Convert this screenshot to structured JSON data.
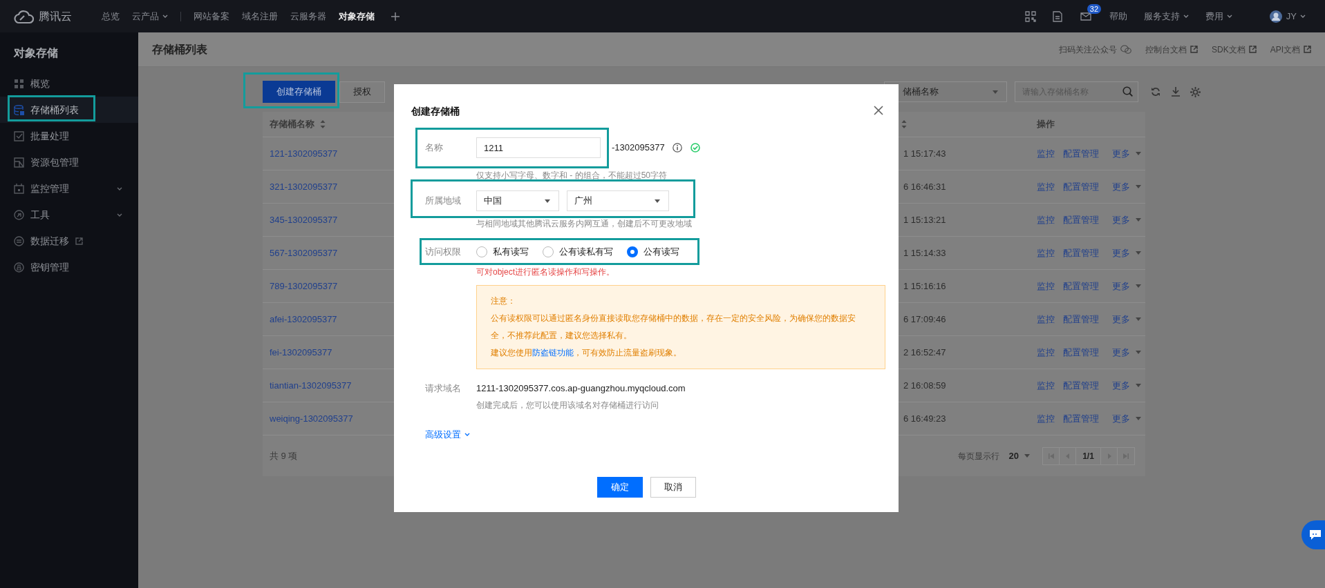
{
  "top_nav": {
    "brand": "腾讯云",
    "items": [
      {
        "label": "总览",
        "selected": false,
        "dropdown": false
      },
      {
        "label": "云产品",
        "selected": false,
        "dropdown": true
      },
      {
        "label": "网站备案",
        "selected": false,
        "dropdown": false
      },
      {
        "label": "域名注册",
        "selected": false,
        "dropdown": false
      },
      {
        "label": "云服务器",
        "selected": false,
        "dropdown": false
      },
      {
        "label": "对象存储",
        "selected": true,
        "dropdown": false
      }
    ],
    "mail_badge": "32",
    "links": [
      {
        "label": "帮助",
        "dropdown": false
      },
      {
        "label": "服务支持",
        "dropdown": true
      },
      {
        "label": "费用",
        "dropdown": true
      }
    ],
    "user": "JY"
  },
  "sidebar": {
    "title": "对象存储",
    "items": [
      {
        "label": "概览",
        "selected": false,
        "expandable": false,
        "external": false
      },
      {
        "label": "存储桶列表",
        "selected": true,
        "expandable": false,
        "external": false
      },
      {
        "label": "批量处理",
        "selected": false,
        "expandable": false,
        "external": false
      },
      {
        "label": "资源包管理",
        "selected": false,
        "expandable": false,
        "external": false
      },
      {
        "label": "监控管理",
        "selected": false,
        "expandable": true,
        "external": false
      },
      {
        "label": "工具",
        "selected": false,
        "expandable": true,
        "external": false
      },
      {
        "label": "数据迁移",
        "selected": false,
        "expandable": false,
        "external": true
      },
      {
        "label": "密钥管理",
        "selected": false,
        "expandable": false,
        "external": false
      }
    ]
  },
  "page_header": {
    "title": "存储桶列表",
    "links": [
      {
        "label": "扫码关注公众号",
        "kind": "wechat"
      },
      {
        "label": "控制台文档",
        "kind": "external"
      },
      {
        "label": "SDK文档",
        "kind": "external"
      },
      {
        "label": "API文档",
        "kind": "external"
      }
    ]
  },
  "toolbar": {
    "create_button": "创建存储桶",
    "auth_button": "授权",
    "filter_select": "储桶名称",
    "search": {
      "placeholder": "请输入存储桶名称"
    }
  },
  "table": {
    "columns": {
      "name": "存储桶名称",
      "actions": "操作"
    },
    "rows": [
      {
        "name": "121-1302095377",
        "column_2": "1 15:17:43",
        "actions": [
          "监控",
          "配置管理",
          "更多"
        ]
      },
      {
        "name": "321-1302095377",
        "column_2": "6 16:46:31",
        "actions": [
          "监控",
          "配置管理",
          "更多"
        ]
      },
      {
        "name": "345-1302095377",
        "column_2": "1 15:13:21",
        "actions": [
          "监控",
          "配置管理",
          "更多"
        ]
      },
      {
        "name": "567-1302095377",
        "column_2": "1 15:14:33",
        "actions": [
          "监控",
          "配置管理",
          "更多"
        ]
      },
      {
        "name": "789-1302095377",
        "column_2": "1 15:16:16",
        "actions": [
          "监控",
          "配置管理",
          "更多"
        ]
      },
      {
        "name": "afei-1302095377",
        "column_2": "6 17:09:46",
        "actions": [
          "监控",
          "配置管理",
          "更多"
        ]
      },
      {
        "name": "fei-1302095377",
        "column_2": "2 16:52:47",
        "actions": [
          "监控",
          "配置管理",
          "更多"
        ]
      },
      {
        "name": "tiantian-1302095377",
        "column_2": "2 16:08:59",
        "actions": [
          "监控",
          "配置管理",
          "更多"
        ]
      },
      {
        "name": "weiqing-1302095377",
        "column_2": "6 16:49:23",
        "actions": [
          "监控",
          "配置管理",
          "更多"
        ]
      }
    ],
    "footer": {
      "total": "共 9 项",
      "page_size_label": "每页显示行",
      "page_size": "20",
      "page": "1/1"
    }
  },
  "modal": {
    "title": "创建存储桶",
    "name": {
      "label": "名称",
      "value": "1211",
      "suffix": "-1302095377",
      "valid": true,
      "hint": "仅支持小写字母、数字和 - 的组合，不能超过50字符"
    },
    "region": {
      "label": "所属地域",
      "selects": [
        "中国",
        "广州"
      ],
      "hint": "与相同地域其他腾讯云服务内网互通，创建后不可更改地域"
    },
    "access": {
      "label": "访问权限",
      "options": [
        {
          "label": "私有读写",
          "selected": false
        },
        {
          "label": "公有读私有写",
          "selected": false
        },
        {
          "label": "公有读写",
          "selected": true
        }
      ],
      "warning": "可对object进行匿名读操作和写操作。",
      "notice": {
        "title": "注意：",
        "text": "公有读权限可以通过匿名身份直接读取您存储桶中的数据，存在一定的安全风险，为确保您的数据安全，不推荐此配置，建议您选择私有。",
        "tip_before": "建议您使用",
        "tip_link": "防盗链功能",
        "tip_after": "，可有效防止流量盗刷现象。"
      }
    },
    "domain": {
      "label": "请求域名",
      "value": "1211-1302095377.cos.ap-guangzhou.myqcloud.com",
      "hint": "创建完成后，您可以使用该域名对存储桶进行访问"
    },
    "advanced": "高级设置",
    "buttons": {
      "confirm": "确定",
      "cancel": "取消"
    }
  }
}
